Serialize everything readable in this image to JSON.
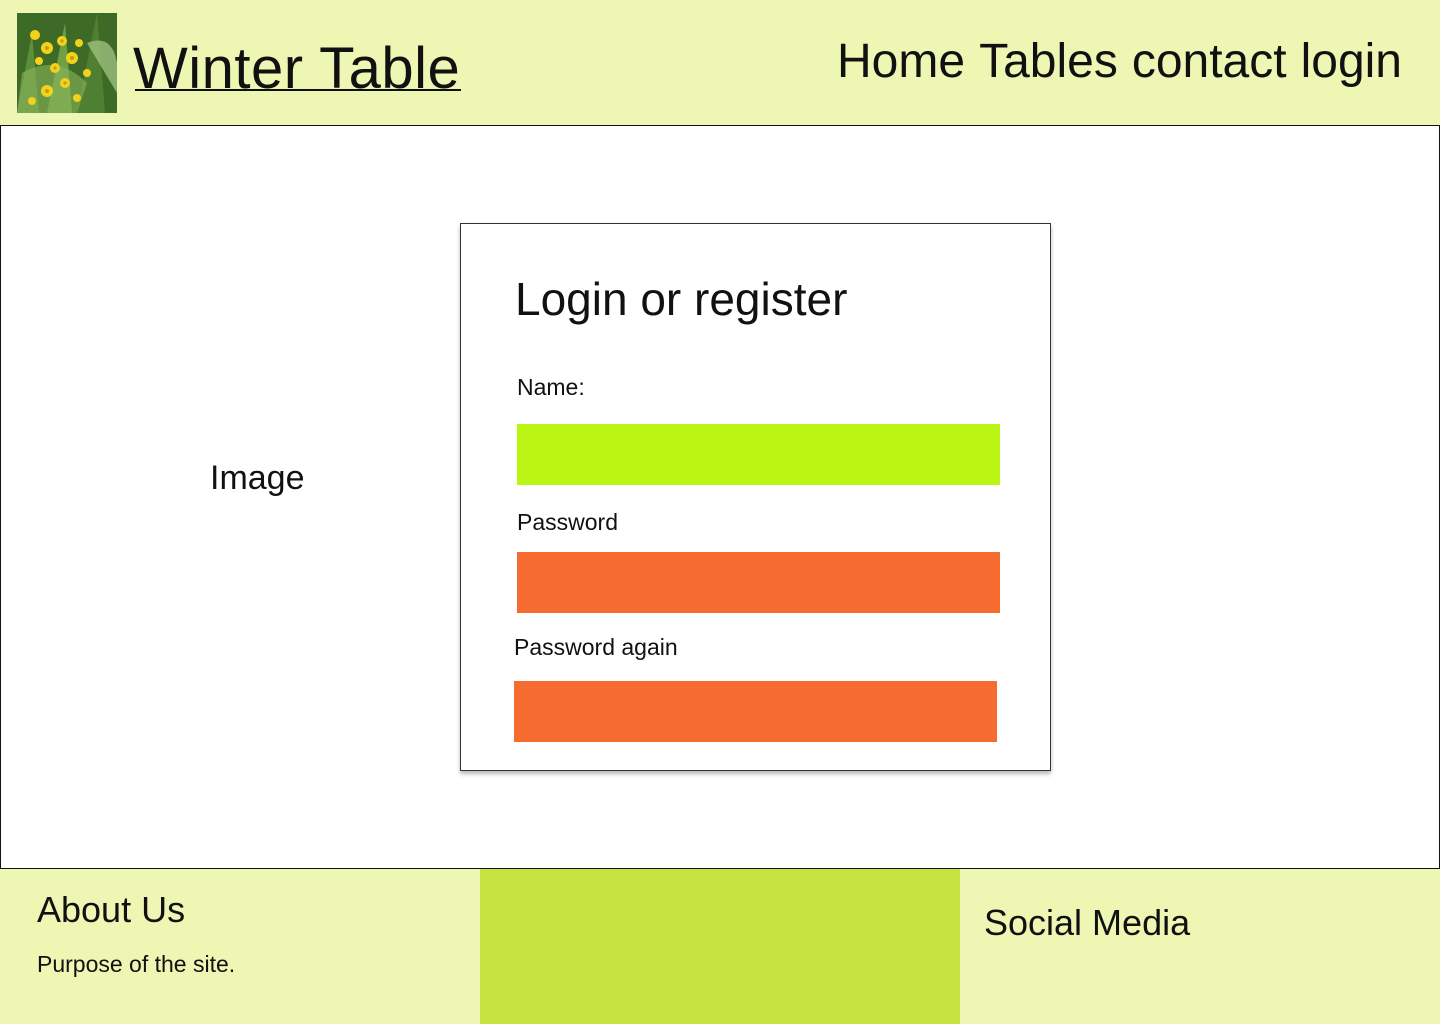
{
  "header": {
    "logo_icon": "flower-photo-logo",
    "title": "Winter Table",
    "nav": [
      "Home",
      "Tables",
      "contact",
      "login"
    ]
  },
  "main": {
    "image_placeholder": "Image",
    "form": {
      "title": "Login or register",
      "name_label": "Name:",
      "name_value": "",
      "password_label": "Password",
      "password_value": "",
      "password_again_label": "Password again",
      "password_again_value": ""
    }
  },
  "footer": {
    "about_title": "About Us",
    "about_text": "Purpose of the site.",
    "social_title": "Social Media"
  },
  "colors": {
    "header_bg": "#eef6b3",
    "name_field": "#bbf513",
    "password_field": "#f66b30",
    "footer_mid": "#c5e442"
  }
}
